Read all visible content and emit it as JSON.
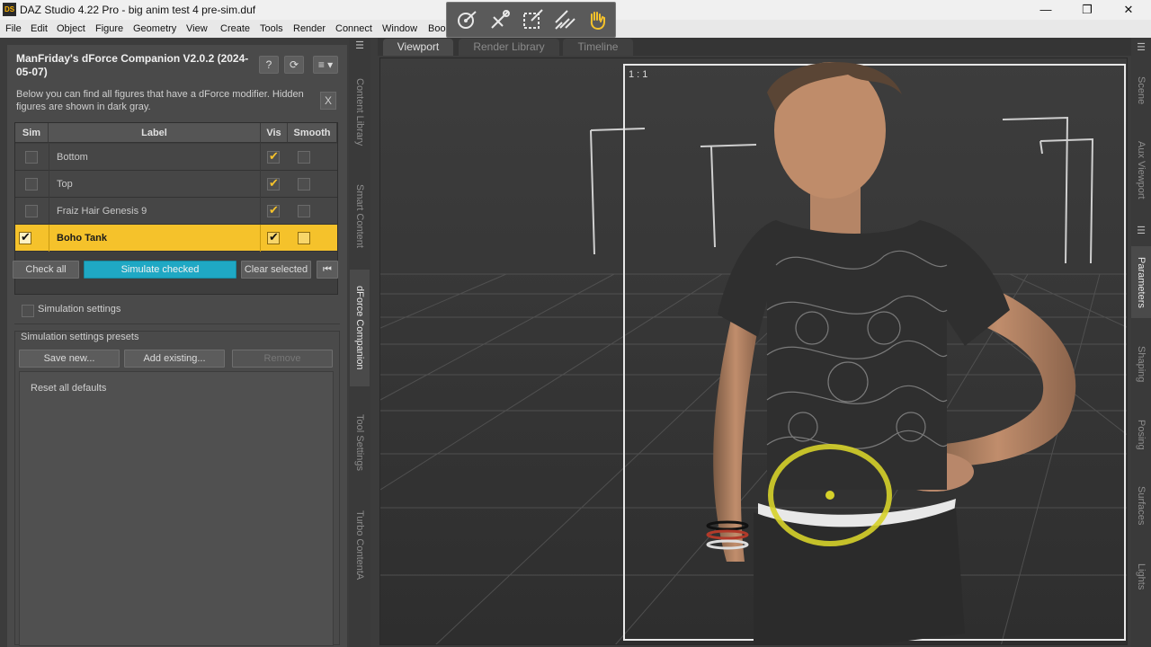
{
  "window": {
    "title": "DAZ Studio 4.22 Pro - big anim test 4 pre-sim.duf",
    "app_icon": "DS",
    "minimize": "—",
    "maximize": "❐",
    "close": "✕"
  },
  "menu": [
    "File",
    "Edit",
    "Object",
    "Figure",
    "Geometry",
    "View",
    "Create",
    "Tools",
    "Render",
    "Connect",
    "Window",
    "Boo"
  ],
  "tool_toolbar": {
    "tools": [
      "universal-tool-icon",
      "transform-tool-icon",
      "node-select-tool-icon",
      "brush-tool-icon",
      "hand-tool-icon"
    ]
  },
  "left_strip_tabs": [
    "Content Library",
    "Smart Content",
    "dForce Companion",
    "Tool Settings",
    "Turbo ContentA"
  ],
  "right_strip_tabs": [
    "Scene",
    "Aux Viewport",
    "Parameters",
    "Shaping",
    "Posing",
    "Surfaces",
    "Lights"
  ],
  "dforce_panel": {
    "title": "ManFriday's dForce Companion V2.0.2 (2024-05-07)",
    "help_btn": "?",
    "refresh_btn": "⟳",
    "menu_btn": "≡ ▾",
    "description": "Below you can find all figures that have a dForce modifier. Hidden figures are shown in dark gray.",
    "close_desc": "X",
    "table": {
      "headers": [
        "Sim",
        "Label",
        "Vis",
        "Smooth"
      ],
      "rows": [
        {
          "label": "Bottom",
          "sim": false,
          "vis": true,
          "smooth": false,
          "selected": false
        },
        {
          "label": "Top",
          "sim": false,
          "vis": true,
          "smooth": false,
          "selected": false
        },
        {
          "label": "Fraiz Hair Genesis 9",
          "sim": false,
          "vis": true,
          "smooth": false,
          "selected": false
        },
        {
          "label": "Boho Tank",
          "sim": true,
          "vis": true,
          "smooth": false,
          "selected": true
        }
      ]
    },
    "buttons": {
      "check_all": "Check all",
      "simulate_checked": "Simulate checked",
      "clear_selected": "Clear selected",
      "skip_first": "⏮"
    },
    "simulation_settings": "Simulation settings",
    "presets": {
      "label": "Simulation settings presets",
      "save_new": "Save new...",
      "add_existing": "Add existing...",
      "remove": "Remove",
      "items": [
        "Reset all defaults"
      ]
    }
  },
  "viewport_tabs": [
    "Viewport",
    "Render Library",
    "Timeline"
  ],
  "viewport": {
    "ratio": "1 : 1"
  },
  "colors": {
    "accent_yellow": "#f5c22b",
    "simulate_button": "#1fa8c4",
    "panel_bg": "#4a4a4a"
  }
}
